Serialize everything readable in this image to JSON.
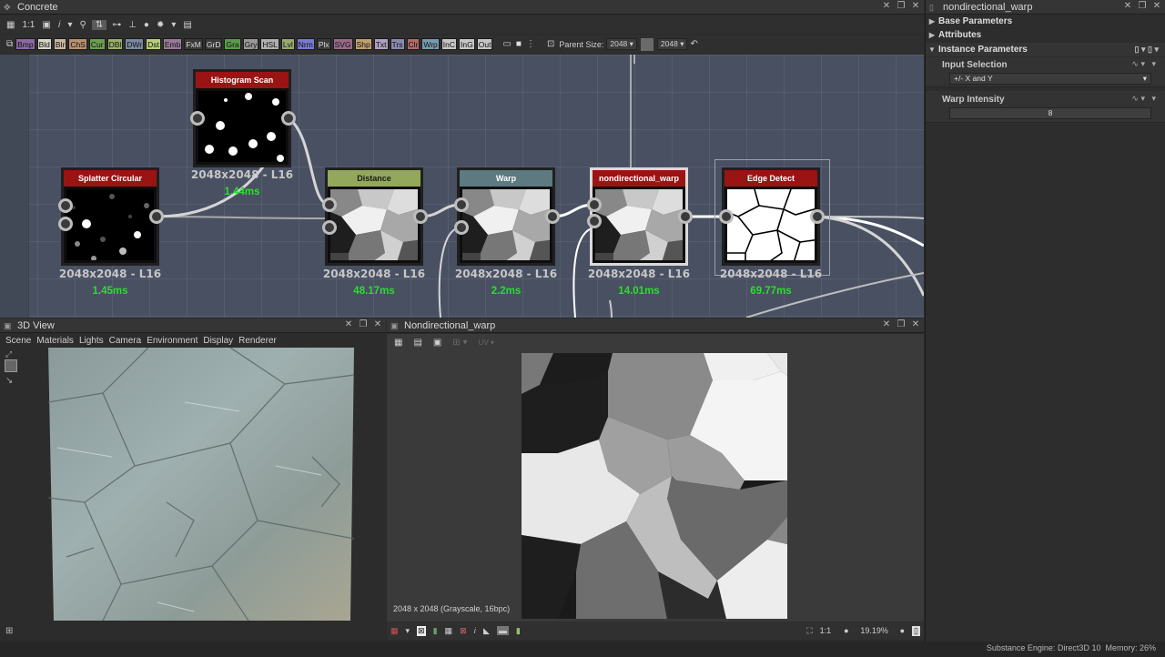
{
  "graph_panel": {
    "title": "Concrete",
    "toolbar_zoom_label": "1:1",
    "library_buttons": [
      {
        "label": "Bmp",
        "color": "#8a6aa0"
      },
      {
        "label": "Bld",
        "color": "#d6d6c6"
      },
      {
        "label": "Blr",
        "color": "#c9b8a0"
      },
      {
        "label": "ChS",
        "color": "#b89070"
      },
      {
        "label": "Cur",
        "color": "#6aa050"
      },
      {
        "label": "DBl",
        "color": "#9ab06a"
      },
      {
        "label": "DWr",
        "color": "#7a8aa0"
      },
      {
        "label": "Dst",
        "color": "#b8d07a"
      },
      {
        "label": "Emb",
        "color": "#9a7a9a"
      },
      {
        "label": "FxM",
        "color": "#3a3a3a"
      },
      {
        "label": "GrD",
        "color": "#3a3a3a"
      },
      {
        "label": "Gra",
        "color": "#5a9a4a"
      },
      {
        "label": "Gry",
        "color": "#9a9a9a"
      },
      {
        "label": "HSL",
        "color": "#b0b0b0"
      },
      {
        "label": "Lvl",
        "color": "#9aaa70"
      },
      {
        "label": "Nrm",
        "color": "#7a7ad0"
      },
      {
        "label": "Plx",
        "color": "#3a3a3a"
      },
      {
        "label": "SVG",
        "color": "#9a6a8a"
      },
      {
        "label": "Shp",
        "color": "#c0a070"
      },
      {
        "label": "Txt",
        "color": "#b0a0c0"
      },
      {
        "label": "Trs",
        "color": "#8a8ab0"
      },
      {
        "label": "Clr",
        "color": "#b06a6a"
      },
      {
        "label": "Wrp",
        "color": "#7a9ab0"
      },
      {
        "label": "InC",
        "color": "#c6c6c6"
      },
      {
        "label": "InG",
        "color": "#c6c6c6"
      },
      {
        "label": "Out",
        "color": "#c6c6c6"
      }
    ],
    "parent_size_label": "Parent Size:",
    "size_value_1": "2048",
    "size_value_2": "2048"
  },
  "nodes": [
    {
      "title": "Splatter Circular",
      "header_color": "#9a1414",
      "resolution": "2048x2048 - L16",
      "time": "1.45ms"
    },
    {
      "title": "Histogram Scan",
      "header_color": "#9a1414",
      "resolution": "2048x2048 - L16",
      "time": "1.44ms"
    },
    {
      "title": "Distance",
      "header_color": "#93a85a",
      "resolution": "2048x2048 - L16",
      "time": "48.17ms"
    },
    {
      "title": "Warp",
      "header_color": "#5c7a80",
      "resolution": "2048x2048 - L16",
      "time": "2.2ms"
    },
    {
      "title": "nondirectional_warp",
      "header_color": "#9a1414",
      "resolution": "2048x2048 - L16",
      "time": "14.01ms"
    },
    {
      "title": "Edge Detect",
      "header_color": "#9a1414",
      "resolution": "2048x2048 - L16",
      "time": "69.77ms"
    }
  ],
  "view3d": {
    "title": "3D View",
    "menu": [
      "Scene",
      "Materials",
      "Lights",
      "Camera",
      "Environment",
      "Display",
      "Renderer"
    ]
  },
  "view2d": {
    "title": "Nondirectional_warp",
    "image_info": "2048 x 2048 (Grayscale, 16bpc)",
    "zoom_ratio": "1:1",
    "zoom_percent": "19.19%",
    "uv_label": "UV"
  },
  "properties": {
    "title": "nondirectional_warp",
    "sections": [
      "Base Parameters",
      "Attributes",
      "Instance Parameters"
    ],
    "input_selection_label": "Input Selection",
    "input_selection_value": "+/- X and Y",
    "warp_intensity_label": "Warp Intensity",
    "warp_intensity_value": "8"
  },
  "status": {
    "engine": "Substance Engine: Direct3D 10",
    "memory": "Memory: 26%"
  }
}
